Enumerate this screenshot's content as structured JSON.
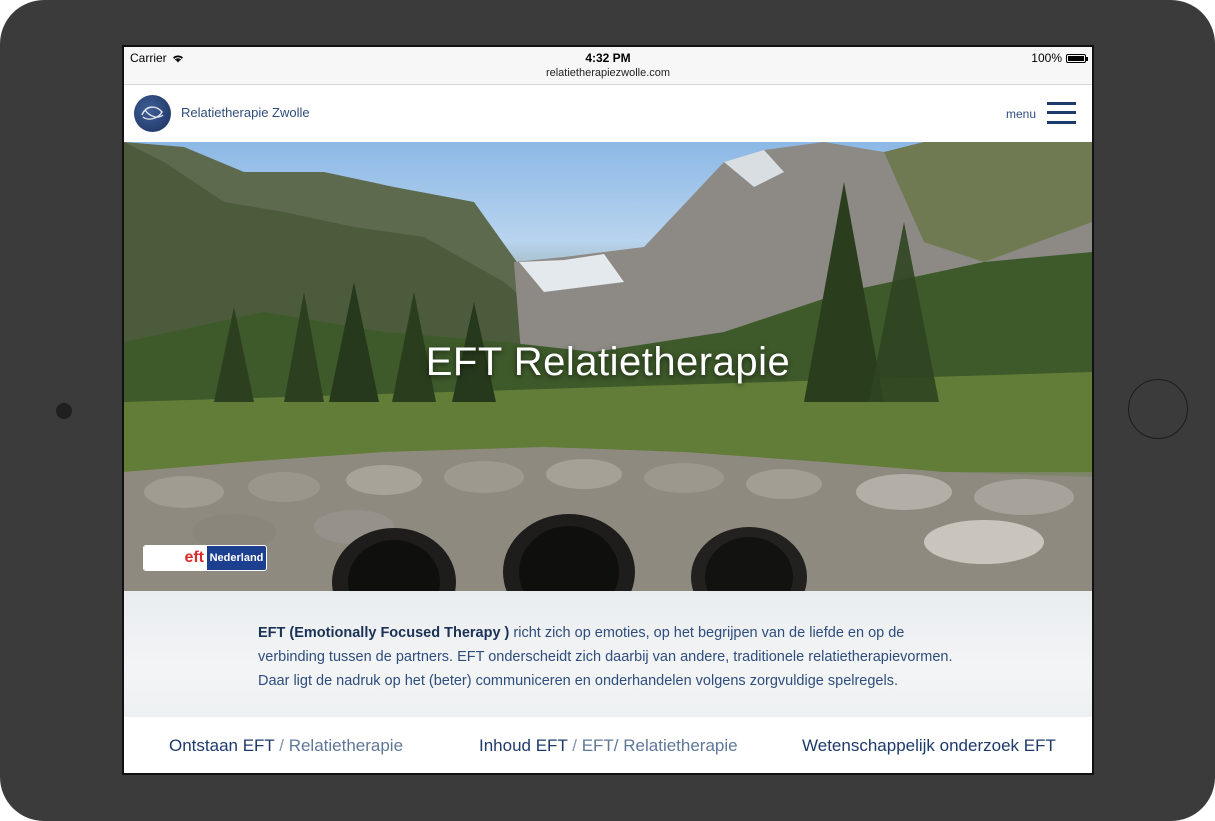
{
  "status_bar": {
    "carrier": "Carrier",
    "time": "4:32 PM",
    "url": "relatietherapiezwolle.com",
    "battery": "100%"
  },
  "header": {
    "brand": "Relatietherapie Zwolle",
    "menu_label": "menu"
  },
  "hero": {
    "title": "EFT Relatietherapie",
    "badge_left": "eft",
    "badge_right": "Nederland"
  },
  "intro": {
    "bold": "EFT (Emotionally Focused Therapy )",
    "text": " richt zich op emoties, op het begrijpen van de liefde en op de verbinding tussen de partners. EFT onderscheidt zich daarbij van andere, traditionele relatietherapievormen. Daar ligt de nadruk op het (beter) communiceren en onderhandelen volgens zorgvuldige spelregels."
  },
  "footer_links": [
    {
      "main": "Ontstaan EFT",
      "sep": " / ",
      "sub": "Relatietherapie"
    },
    {
      "main": "Inhoud EFT",
      "sep": " / ",
      "sub": "EFT/ Relatietherapie"
    },
    {
      "main": "Wetenschappelijk onderzoek EFT",
      "sep": "",
      "sub": ""
    }
  ],
  "colors": {
    "brand_blue": "#1e3a6a",
    "text_blue": "#2e4d7c",
    "device_frame": "#3b3b3b"
  }
}
